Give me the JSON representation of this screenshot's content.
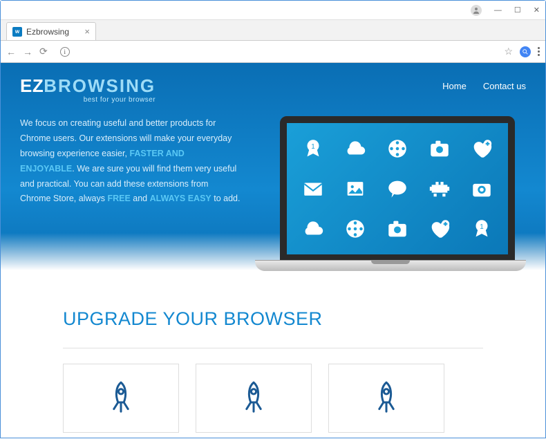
{
  "chrome": {
    "tab_title": "Ezbrowsing",
    "window_buttons": {
      "min": "—",
      "max": "☐",
      "close": "✕"
    }
  },
  "site": {
    "logo": {
      "a": "EZ",
      "b": "BROWSING",
      "tag": "best for your browser"
    },
    "nav": {
      "home": "Home",
      "contact": "Contact us"
    },
    "hero": {
      "t1": "We focus on creating useful and better products for Chrome users. Our extensions will make your everyday browsing experience easier, ",
      "h1": "FASTER AND ENJOYABLE",
      "t2": ". We are sure you will find them very useful and practical. You can add these extensions from Chrome Store, always ",
      "h2": "FREE",
      "t3": " and ",
      "h3": "ALWAYS EASY",
      "t4": " to add."
    },
    "section_title": "UPGRADE YOUR BROWSER",
    "app_icons": [
      "ribbon-1",
      "cloud",
      "film-reel",
      "camera",
      "heart-plus",
      "mail",
      "photo",
      "chat",
      "game",
      "camera-solid",
      "cloud-2",
      "film-reel-2",
      "camera-2",
      "heart-plus-2",
      "ribbon-2"
    ]
  }
}
